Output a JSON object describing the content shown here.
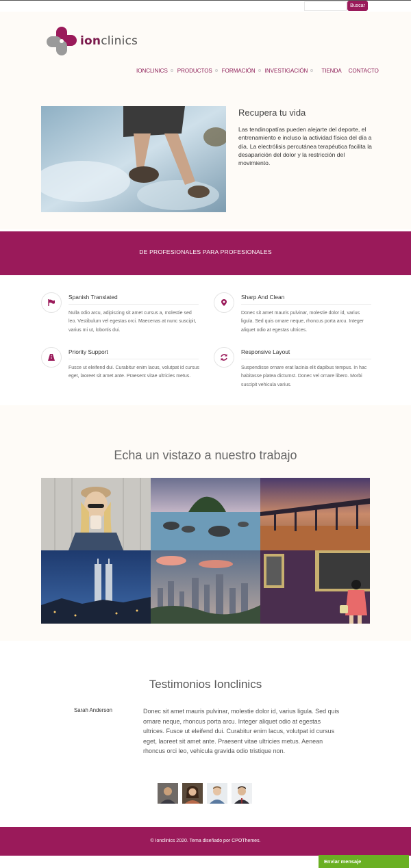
{
  "search": {
    "placeholder": "",
    "button_label": "Buscar"
  },
  "brand": {
    "logo_prefix": "ion",
    "logo_suffix": "clinics"
  },
  "nav": {
    "items": [
      {
        "label": "IONCLINICS"
      },
      {
        "label": "PRODUCTOS"
      },
      {
        "label": "FORMACIÓN"
      },
      {
        "label": "INVESTIGACIÓN"
      },
      {
        "label": "TIENDA"
      },
      {
        "label": "CONTACTO"
      }
    ]
  },
  "hero": {
    "title": "Recupera tu vida",
    "text": "Las tendinopatías pueden alejarte del deporte, el entrenamiento e incluso la actividad física del día a día. La electrólisis percutánea terapéutica facilita la desaparición del dolor y la restricción del movimiento."
  },
  "banner": {
    "text": "DE PROFESIONALES PARA PROFESIONALES"
  },
  "features": [
    {
      "title": "Spanish Translated",
      "icon": "flag-icon",
      "text": "Nulla odio arcu, adipiscing sit amet cursus a, molestie sed leo. Vestibulum vel egestas orci. Maecenas at nunc suscipit, varius mi ut, lobortis dui."
    },
    {
      "title": "Sharp And Clean",
      "icon": "map-marker-icon",
      "text": "Donec sit amet mauris pulvinar, molestie dolor id, varius ligula. Sed quis ornare neque, rhoncus porta arcu. Integer aliquet odio at egestas ultrices."
    },
    {
      "title": "Priority Support",
      "icon": "road-icon",
      "text": "Fusce ut eleifend dui. Curabitur enim lacus, volutpat id cursus eget, laoreet sit amet ante. Praesent vitae ultricies metus."
    },
    {
      "title": "Responsive Layout",
      "icon": "refresh-icon",
      "text": "Suspendisse ornare erat lacinia elit dapibus tempus. In hac habitasse platea dictumst. Donec vel ornare libero. Morbi suscipit vehicula varius."
    }
  ],
  "work": {
    "title": "Echa un vistazo a nuestro trabajo",
    "images": [
      "woman-coffee-photo",
      "rocky-coast-photo",
      "pier-sunset-photo",
      "city-towers-photo",
      "city-skyline-photo",
      "gallery-visitor-photo"
    ]
  },
  "testimonials": {
    "title": "Testimonios Ionclinics",
    "name": "Sarah Anderson",
    "quote": "Donec sit amet mauris pulvinar, molestie dolor id, varius ligula. Sed quis ornare neque, rhoncus porta arcu. Integer aliquet odio at egestas ultrices. Fusce ut eleifend dui. Curabitur enim lacus, volutpat id cursus eget, laoreet sit amet ante. Praesent vitae ultricies metus. Aenean rhoncus orci leo, vehicula gravida odio tristique non."
  },
  "footer": {
    "text": "© Ionclinics 2020. Tema diseñado por CPOThemes."
  },
  "chat": {
    "label": "Enviar mensaje"
  },
  "colors": {
    "brand": "#9a1a5a",
    "chat_green": "#6ab023",
    "header_bg": "#fefbf7"
  }
}
